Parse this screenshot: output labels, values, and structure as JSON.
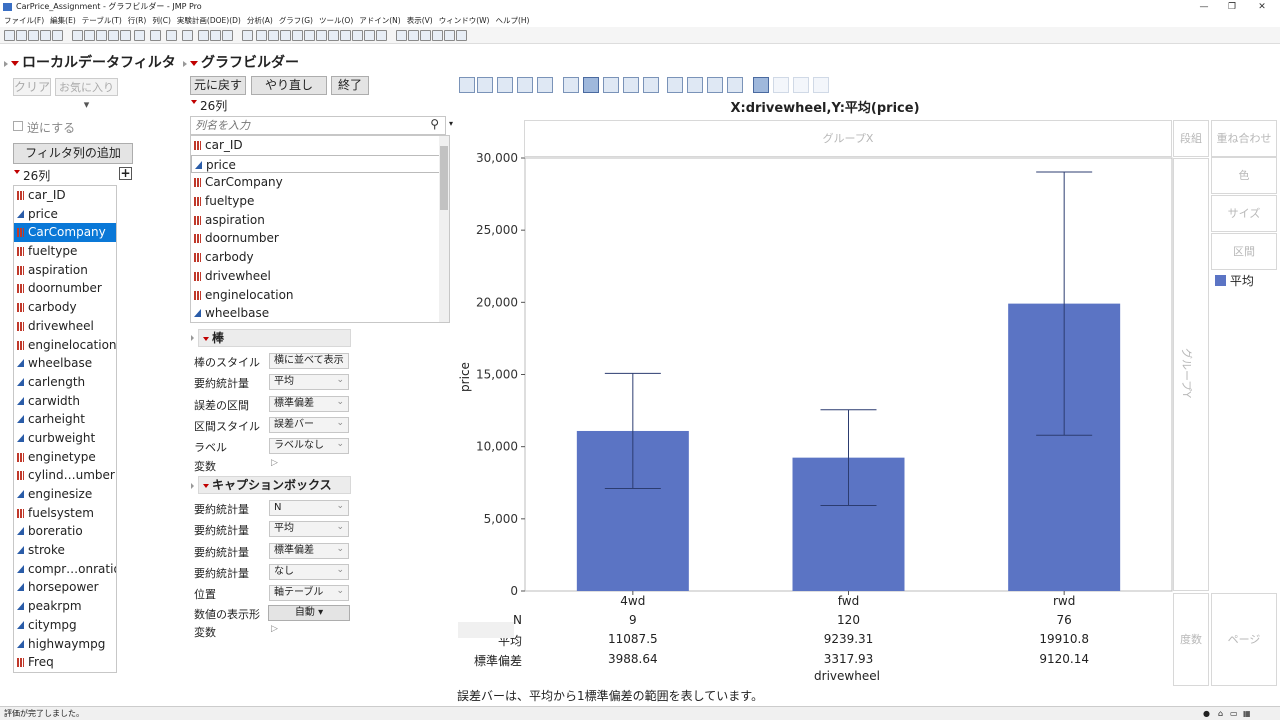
{
  "window": {
    "title": "CarPrice_Assignment - グラフビルダー - JMP Pro",
    "menu": [
      "ファイル(F)",
      "編集(E)",
      "テーブル(T)",
      "行(R)",
      "列(C)",
      "実験計画(DOE)(D)",
      "分析(A)",
      "グラフ(G)",
      "ツール(O)",
      "アドイン(N)",
      "表示(V)",
      "ウィンドウ(W)",
      "ヘルプ(H)"
    ]
  },
  "filter": {
    "title": "ローカルデータフィルタ",
    "clear": "クリア",
    "favorites": "お気に入り",
    "invert": "逆にする",
    "add_filter": "フィルタ列の追加",
    "count": "26列",
    "columns": [
      "car_ID",
      "price",
      "CarCompany",
      "fueltype",
      "aspiration",
      "doornumber",
      "carbody",
      "drivewheel",
      "enginelocation",
      "wheelbase",
      "carlength",
      "carwidth",
      "carheight",
      "curbweight",
      "enginetype",
      "cylind…umber",
      "enginesize",
      "fuelsystem",
      "boreratio",
      "stroke",
      "compr…onratio",
      "horsepower",
      "peakrpm",
      "citympg",
      "highwaympg",
      "Freq"
    ],
    "column_types": [
      "nom",
      "cont",
      "nom",
      "nom",
      "nom",
      "nom",
      "nom",
      "nom",
      "nom",
      "cont",
      "cont",
      "cont",
      "cont",
      "cont",
      "nom",
      "nom",
      "cont",
      "nom",
      "cont",
      "cont",
      "cont",
      "cont",
      "cont",
      "cont",
      "cont",
      "nom"
    ],
    "selected": "CarCompany"
  },
  "builder": {
    "title": "グラフビルダー",
    "undo": "元に戻す",
    "redo": "やり直し",
    "done": "終了",
    "count": "26列",
    "search_placeholder": "列名を入力",
    "columns": [
      "car_ID",
      "price",
      "CarCompany",
      "fueltype",
      "aspiration",
      "doornumber",
      "carbody",
      "drivewheel",
      "enginelocation",
      "wheelbase"
    ],
    "column_types": [
      "nom",
      "cont",
      "nom",
      "nom",
      "nom",
      "nom",
      "nom",
      "nom",
      "nom",
      "cont"
    ],
    "bar_section": "棒",
    "bar_rows": [
      {
        "label": "棒のスタイル",
        "value": "横に並べて表示"
      },
      {
        "label": "要約統計量",
        "value": "平均"
      },
      {
        "label": "誤差の区間",
        "value": "標準偏差"
      },
      {
        "label": "区間スタイル",
        "value": "誤差バー"
      },
      {
        "label": "ラベル",
        "value": "ラベルなし"
      }
    ],
    "bar_var": "変数",
    "caption_section": "キャプションボックス",
    "caption_rows": [
      {
        "label": "要約統計量",
        "value": "N"
      },
      {
        "label": "要約統計量",
        "value": "平均"
      },
      {
        "label": "要約統計量",
        "value": "標準偏差"
      },
      {
        "label": "要約統計量",
        "value": "なし"
      },
      {
        "label": "位置",
        "value": "軸テーブル"
      }
    ],
    "format_label": "数値の表示形",
    "format_value": "自動",
    "caption_var": "変数"
  },
  "graph": {
    "title": "X:drivewheel,Y:平均(price)",
    "group_x": "グループX",
    "group_y": "グループY",
    "wrap": "段組",
    "overlay": "重ね合わせ",
    "color": "色",
    "size": "サイズ",
    "interval": "区間",
    "freq": "度数",
    "page": "ページ",
    "legend_item": "平均",
    "footnote": "誤差バーは、平均から1標準偏差の範囲を表しています。",
    "row_labels": [
      "N",
      "平均",
      "標準偏差"
    ],
    "table": [
      {
        "n": "9",
        "mean": "11087.5",
        "sd": "3988.64"
      },
      {
        "n": "120",
        "mean": "9239.31",
        "sd": "3317.93"
      },
      {
        "n": "76",
        "mean": "19910.8",
        "sd": "9120.14"
      }
    ]
  },
  "chart_data": {
    "type": "bar",
    "title": "X:drivewheel,Y:平均(price)",
    "xlabel": "drivewheel",
    "ylabel": "price",
    "categories": [
      "4wd",
      "fwd",
      "rwd"
    ],
    "series": [
      {
        "name": "平均",
        "values": [
          11087.5,
          9239.31,
          19910.8
        ]
      }
    ],
    "error": [
      3988.64,
      3317.93,
      9120.14
    ],
    "ylim": [
      0,
      30000
    ],
    "yticks": [
      0,
      5000,
      10000,
      15000,
      20000,
      25000,
      30000
    ],
    "ytick_labels": [
      "0",
      "5,000",
      "10,000",
      "15,000",
      "20,000",
      "25,000",
      "30,000"
    ],
    "bar_color": "#5b74c4"
  },
  "status": {
    "text": "評価が完了しました。"
  }
}
